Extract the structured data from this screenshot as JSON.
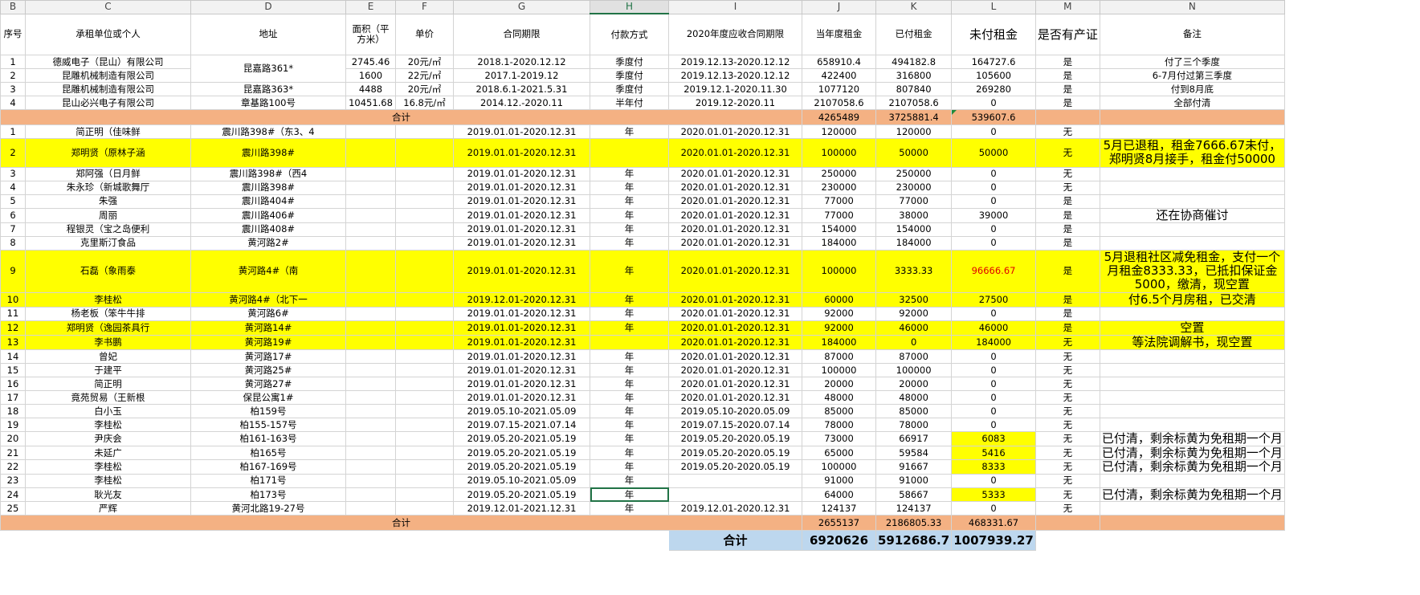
{
  "columns": [
    "B",
    "C",
    "D",
    "E",
    "F",
    "G",
    "H",
    "I",
    "J",
    "K",
    "L",
    "M",
    "N"
  ],
  "selected_column": "H",
  "headers": [
    "序号",
    "承租单位或个人",
    "地址",
    "面积（平方米）",
    "单价",
    "合同期限",
    "付款方式",
    "2020年度应收合同期限",
    "当年度租金",
    "已付租金",
    "未付租金",
    "是否有产证",
    "备注"
  ],
  "group1": [
    {
      "no": "1",
      "tenant": "德威电子（昆山）有限公司",
      "addr": "",
      "area": "2745.46",
      "price": "20元/㎡",
      "term": "2018.1-2020.12.12",
      "pay": "季度付",
      "period": "2019.12.13-2020.12.12",
      "rent": "658910.4",
      "paid": "494182.8",
      "unpaid": "164727.6",
      "cert": "是",
      "note": "付了三个季度"
    },
    {
      "no": "2",
      "tenant": "昆雕机械制造有限公司",
      "addr": "",
      "area": "1600",
      "price": "22元/㎡",
      "term": "2017.1-2019.12",
      "pay": "季度付",
      "period": "2019.12.13-2020.12.12",
      "rent": "422400",
      "paid": "316800",
      "unpaid": "105600",
      "cert": "是",
      "note": "6-7月付过第三季度"
    },
    {
      "no": "3",
      "tenant": "昆雕机械制造有限公司",
      "addr": "昆嘉路363*",
      "area": "4488",
      "price": "20元/㎡",
      "term": "2018.6.1-2021.5.31",
      "pay": "季度付",
      "period": "2019.12.1-2020.11.30",
      "rent": "1077120",
      "paid": "807840",
      "unpaid": "269280",
      "cert": "是",
      "note": "付到8月底"
    },
    {
      "no": "4",
      "tenant": "昆山必兴电子有限公司",
      "addr": "章基路100号",
      "area": "10451.68",
      "price": "16.8元/㎡",
      "term": "2014.12.-2020.11",
      "pay": "半年付",
      "period": "2019.12-2020.11",
      "rent": "2107058.6",
      "paid": "2107058.6",
      "unpaid": "0",
      "cert": "是",
      "note": "全部付清"
    }
  ],
  "group1_merged_addr": "昆嘉路361*",
  "subtotal1": {
    "label": "合计",
    "rent": "4265489",
    "paid": "3725881.4",
    "unpaid": "539607.6"
  },
  "group2": [
    {
      "no": "1",
      "tenant": "简正明（佳味鲜",
      "addr": "震川路398#（东3、4",
      "term": "2019.01.01-2020.12.31",
      "pay": "年",
      "period": "2020.01.01-2020.12.31",
      "rent": "120000",
      "paid": "120000",
      "unpaid": "0",
      "cert": "无",
      "note": ""
    },
    {
      "no": "2",
      "tenant": "郑明贤（原林子涵",
      "addr": "震川路398#",
      "term": "2019.01.01-2020.12.31",
      "pay": "",
      "period": "2020.01.01-2020.12.31",
      "rent": "100000",
      "paid": "50000",
      "unpaid": "50000",
      "cert": "无",
      "note": "5月已退租，租金7666.67未付，郑明贤8月接手，租金付50000"
    },
    {
      "no": "3",
      "tenant": "郑阿强（日月鲜",
      "addr": "震川路398#（西4",
      "term": "2019.01.01-2020.12.31",
      "pay": "年",
      "period": "2020.01.01-2020.12.31",
      "rent": "250000",
      "paid": "250000",
      "unpaid": "0",
      "cert": "无",
      "note": ""
    },
    {
      "no": "4",
      "tenant": "朱永珍（新城歌舞厅",
      "addr": "震川路398#",
      "term": "2019.01.01-2020.12.31",
      "pay": "年",
      "period": "2020.01.01-2020.12.31",
      "rent": "230000",
      "paid": "230000",
      "unpaid": "0",
      "cert": "无",
      "note": ""
    },
    {
      "no": "5",
      "tenant": "朱强",
      "addr": "震川路404#",
      "term": "2019.01.01-2020.12.31",
      "pay": "年",
      "period": "2020.01.01-2020.12.31",
      "rent": "77000",
      "paid": "77000",
      "unpaid": "0",
      "cert": "是",
      "note": ""
    },
    {
      "no": "6",
      "tenant": "周丽",
      "addr": "震川路406#",
      "term": "2019.01.01-2020.12.31",
      "pay": "年",
      "period": "2020.01.01-2020.12.31",
      "rent": "77000",
      "paid": "38000",
      "unpaid": "39000",
      "cert": "是",
      "note": "还在协商催讨"
    },
    {
      "no": "7",
      "tenant": "程银灵（宝之岛便利",
      "addr": "震川路408#",
      "term": "2019.01.01-2020.12.31",
      "pay": "年",
      "period": "2020.01.01-2020.12.31",
      "rent": "154000",
      "paid": "154000",
      "unpaid": "0",
      "cert": "是",
      "note": ""
    },
    {
      "no": "8",
      "tenant": "克里斯汀食品",
      "addr": "黄河路2#",
      "term": "2019.01.01-2020.12.31",
      "pay": "年",
      "period": "2020.01.01-2020.12.31",
      "rent": "184000",
      "paid": "184000",
      "unpaid": "0",
      "cert": "是",
      "note": ""
    },
    {
      "no": "9",
      "tenant": "石磊（象雨泰",
      "addr": "黄河路4#（南",
      "term": "2019.01.01-2020.12.31",
      "pay": "年",
      "period": "2020.01.01-2020.12.31",
      "rent": "100000",
      "paid": "3333.33",
      "unpaid": "96666.67",
      "cert": "是",
      "note": "5月退租社区减免租金，支付一个月租金8333.33，已抵扣保证金5000，缴清，现空置"
    },
    {
      "no": "10",
      "tenant": "李桂松",
      "addr": "黄河路4#（北下一",
      "term": "2019.12.01-2020.12.31",
      "pay": "年",
      "period": "2020.01.01-2020.12.31",
      "rent": "60000",
      "paid": "32500",
      "unpaid": "27500",
      "cert": "是",
      "note": "付6.5个月房租，已交清"
    },
    {
      "no": "11",
      "tenant": "杨老板（笨牛牛排",
      "addr": "黄河路6#",
      "term": "2019.01.01-2020.12.31",
      "pay": "年",
      "period": "2020.01.01-2020.12.31",
      "rent": "92000",
      "paid": "92000",
      "unpaid": "0",
      "cert": "是",
      "note": ""
    },
    {
      "no": "12",
      "tenant": "郑明贤（逸园茶具行",
      "addr": "黄河路14#",
      "term": "2019.01.01-2020.12.31",
      "pay": "年",
      "period": "2020.01.01-2020.12.31",
      "rent": "92000",
      "paid": "46000",
      "unpaid": "46000",
      "cert": "是",
      "note": "空置"
    },
    {
      "no": "13",
      "tenant": "李书鹏",
      "addr": "黄河路19#",
      "term": "2019.01.01-2020.12.31",
      "pay": "",
      "period": "2020.01.01-2020.12.31",
      "rent": "184000",
      "paid": "0",
      "unpaid": "184000",
      "cert": "无",
      "note": "等法院调解书，现空置"
    },
    {
      "no": "14",
      "tenant": "曾妃",
      "addr": "黄河路17#",
      "term": "2019.01.01-2020.12.31",
      "pay": "年",
      "period": "2020.01.01-2020.12.31",
      "rent": "87000",
      "paid": "87000",
      "unpaid": "0",
      "cert": "无",
      "note": ""
    },
    {
      "no": "15",
      "tenant": "于建平",
      "addr": "黄河路25#",
      "term": "2019.01.01-2020.12.31",
      "pay": "年",
      "period": "2020.01.01-2020.12.31",
      "rent": "100000",
      "paid": "100000",
      "unpaid": "0",
      "cert": "无",
      "note": ""
    },
    {
      "no": "16",
      "tenant": "简正明",
      "addr": "黄河路27#",
      "term": "2019.01.01-2020.12.31",
      "pay": "年",
      "period": "2020.01.01-2020.12.31",
      "rent": "20000",
      "paid": "20000",
      "unpaid": "0",
      "cert": "无",
      "note": ""
    },
    {
      "no": "17",
      "tenant": "竟苑贸易（王新根",
      "addr": "保昆公寓1#",
      "term": "2019.01.01-2020.12.31",
      "pay": "年",
      "period": "2020.01.01-2020.12.31",
      "rent": "48000",
      "paid": "48000",
      "unpaid": "0",
      "cert": "无",
      "note": ""
    },
    {
      "no": "18",
      "tenant": "白小玉",
      "addr": "柏159号",
      "term": "2019.05.10-2021.05.09",
      "pay": "年",
      "period": "2019.05.10-2020.05.09",
      "rent": "85000",
      "paid": "85000",
      "unpaid": "0",
      "cert": "无",
      "note": ""
    },
    {
      "no": "19",
      "tenant": "李桂松",
      "addr": "柏155-157号",
      "term": "2019.07.15-2021.07.14",
      "pay": "年",
      "period": "2019.07.15-2020.07.14",
      "rent": "78000",
      "paid": "78000",
      "unpaid": "0",
      "cert": "无",
      "note": ""
    },
    {
      "no": "20",
      "tenant": "尹庆会",
      "addr": "柏161-163号",
      "term": "2019.05.20-2021.05.19",
      "pay": "年",
      "period": "2019.05.20-2020.05.19",
      "rent": "73000",
      "paid": "66917",
      "unpaid": "6083",
      "cert": "无",
      "note": "已付清，剩余标黄为免租期一个月"
    },
    {
      "no": "21",
      "tenant": "未延广",
      "addr": "柏165号",
      "term": "2019.05.20-2021.05.19",
      "pay": "年",
      "period": "2019.05.20-2020.05.19",
      "rent": "65000",
      "paid": "59584",
      "unpaid": "5416",
      "cert": "无",
      "note": "已付清，剩余标黄为免租期一个月"
    },
    {
      "no": "22",
      "tenant": "李桂松",
      "addr": "柏167-169号",
      "term": "2019.05.20-2021.05.19",
      "pay": "年",
      "period": "2019.05.20-2020.05.19",
      "rent": "100000",
      "paid": "91667",
      "unpaid": "8333",
      "cert": "无",
      "note": "已付清，剩余标黄为免租期一个月"
    },
    {
      "no": "23",
      "tenant": "李桂松",
      "addr": "柏171号",
      "term": "2019.05.10-2021.05.09",
      "pay": "年",
      "period": "",
      "rent": "91000",
      "paid": "91000",
      "unpaid": "0",
      "cert": "无",
      "note": ""
    },
    {
      "no": "24",
      "tenant": "耿光友",
      "addr": "柏173号",
      "term": "2019.05.20-2021.05.19",
      "pay": "年",
      "period": "",
      "rent": "64000",
      "paid": "58667",
      "unpaid": "5333",
      "cert": "无",
      "note": "已付清，剩余标黄为免租期一个月"
    },
    {
      "no": "25",
      "tenant": "严辉",
      "addr": "黄河北路19-27号",
      "term": "2019.12.01-2021.12.31",
      "pay": "年",
      "period": "2019.12.01-2020.12.31",
      "rent": "124137",
      "paid": "124137",
      "unpaid": "0",
      "cert": "无",
      "note": ""
    }
  ],
  "subtotal2": {
    "label": "合计",
    "rent": "2655137",
    "paid": "2186805.33",
    "unpaid": "468331.67"
  },
  "grand_total": {
    "label": "合计",
    "rent": "6920626",
    "paid": "5912686.7",
    "unpaid": "1007939.27"
  },
  "colors": {
    "yellow": "#ffff00",
    "orange": "#f4b183",
    "blue": "#bdd7ee",
    "red": "#e00000",
    "green": "#217346"
  }
}
